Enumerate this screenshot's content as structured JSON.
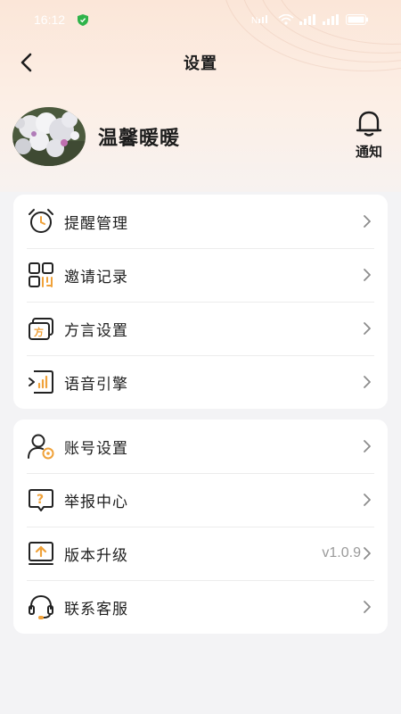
{
  "status_bar": {
    "time": "16:12",
    "battery": ""
  },
  "nav": {
    "title": "设置"
  },
  "profile": {
    "username": "温馨暖暖"
  },
  "notification": {
    "label": "通知"
  },
  "group1": [
    {
      "label": "提醒管理",
      "icon": "alarm-clock-icon"
    },
    {
      "label": "邀请记录",
      "icon": "qr-code-icon"
    },
    {
      "label": "方言设置",
      "icon": "dialect-icon"
    },
    {
      "label": "语音引擎",
      "icon": "voice-engine-icon"
    }
  ],
  "group2": [
    {
      "label": "账号设置",
      "icon": "account-icon"
    },
    {
      "label": "举报中心",
      "icon": "report-icon"
    },
    {
      "label": "版本升级",
      "icon": "upgrade-icon",
      "value": "v1.0.9"
    },
    {
      "label": "联系客服",
      "icon": "headset-icon"
    }
  ],
  "colors": {
    "accent": "#f0a23a",
    "text": "#1f1f1f",
    "muted": "#9a9a9a"
  }
}
